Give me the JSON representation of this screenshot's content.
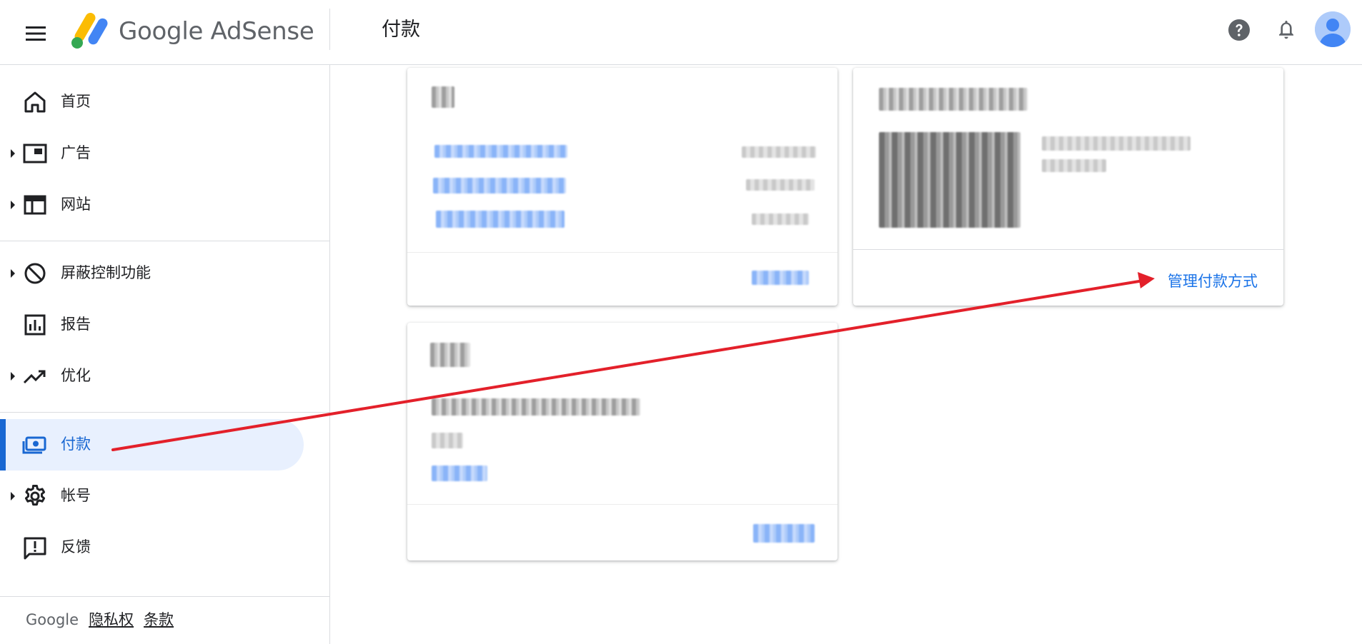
{
  "header": {
    "brand_google": "Google",
    "brand_product": "AdSense",
    "page_title": "付款"
  },
  "sidebar": {
    "items": [
      {
        "label": "首页",
        "icon": "home-icon",
        "expandable": false
      },
      {
        "label": "广告",
        "icon": "ads-icon",
        "expandable": true
      },
      {
        "label": "网站",
        "icon": "sites-icon",
        "expandable": true
      },
      {
        "label": "屏蔽控制功能",
        "icon": "block-icon",
        "expandable": true
      },
      {
        "label": "报告",
        "icon": "report-icon",
        "expandable": false
      },
      {
        "label": "优化",
        "icon": "trending-up-icon",
        "expandable": true
      },
      {
        "label": "付款",
        "icon": "payments-icon",
        "expandable": false,
        "active": true
      },
      {
        "label": "帐号",
        "icon": "gear-icon",
        "expandable": true
      },
      {
        "label": "反馈",
        "icon": "feedback-icon",
        "expandable": false
      }
    ],
    "footer": {
      "google": "Google",
      "privacy": "隐私权",
      "terms": "条款"
    }
  },
  "main": {
    "payment_methods_card": {
      "manage_link": "管理付款方式"
    }
  },
  "colors": {
    "accent": "#1a73e8",
    "active_bg": "#e8f0fe",
    "annotation_arrow": "#e3202a"
  }
}
